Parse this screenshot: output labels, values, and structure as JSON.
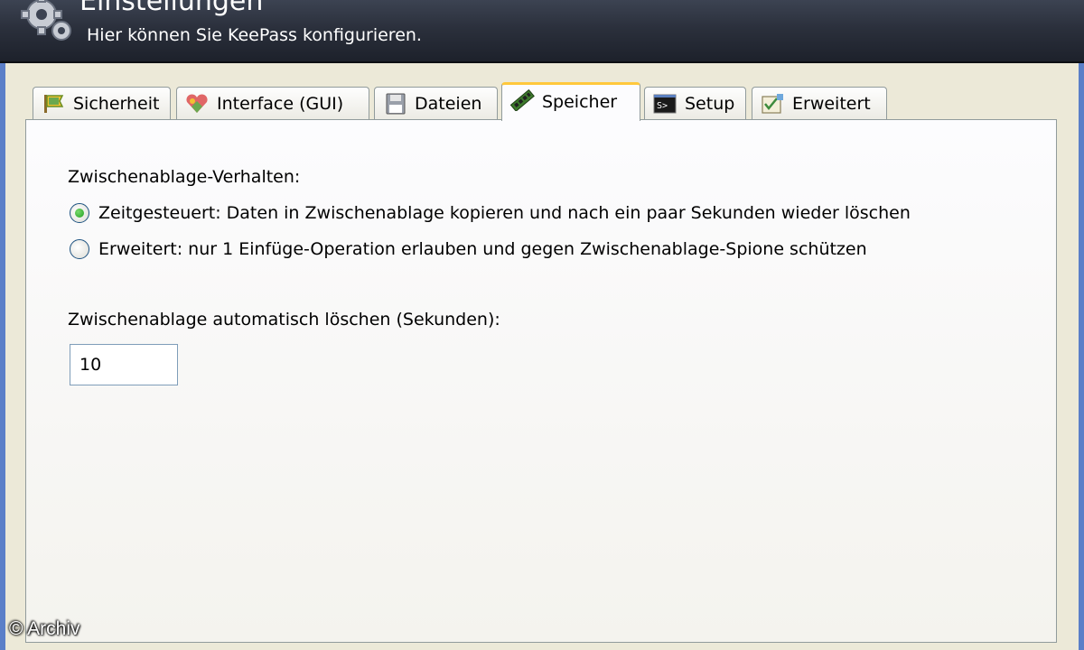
{
  "header": {
    "title": "Einstellungen",
    "subtitle": "Hier können Sie KeePass konfigurieren.",
    "icon": "gears-icon"
  },
  "tabs": [
    {
      "label": "Sicherheit",
      "icon": "security-flag-icon",
      "active": false
    },
    {
      "label": "Interface (GUI)",
      "icon": "interface-colors-icon",
      "active": false
    },
    {
      "label": "Dateien",
      "icon": "floppy-disk-icon",
      "active": false
    },
    {
      "label": "Speicher",
      "icon": "memory-module-icon",
      "active": true
    },
    {
      "label": "Setup",
      "icon": "console-icon",
      "active": false
    },
    {
      "label": "Erweitert",
      "icon": "advanced-checklist-icon",
      "active": false
    }
  ],
  "memory": {
    "clipboard_behavior_label": "Zwischenablage-Verhalten:",
    "options": [
      {
        "label": "Zeitgesteuert: Daten in Zwischenablage kopieren und nach ein paar Sekunden wieder löschen",
        "selected": true
      },
      {
        "label": "Erweitert: nur 1 Einfüge-Operation erlauben und gegen Zwischenablage-Spione schützen",
        "selected": false
      }
    ],
    "auto_clear_label": "Zwischenablage automatisch löschen (Sekunden):",
    "auto_clear_value": "10"
  },
  "watermark": "© Archiv",
  "colors": {
    "header_bg": "#2b303c",
    "window_bg": "#ece9d8",
    "active_tab_accent": "#ffc83c",
    "frame_blue": "#5b7fc8"
  }
}
